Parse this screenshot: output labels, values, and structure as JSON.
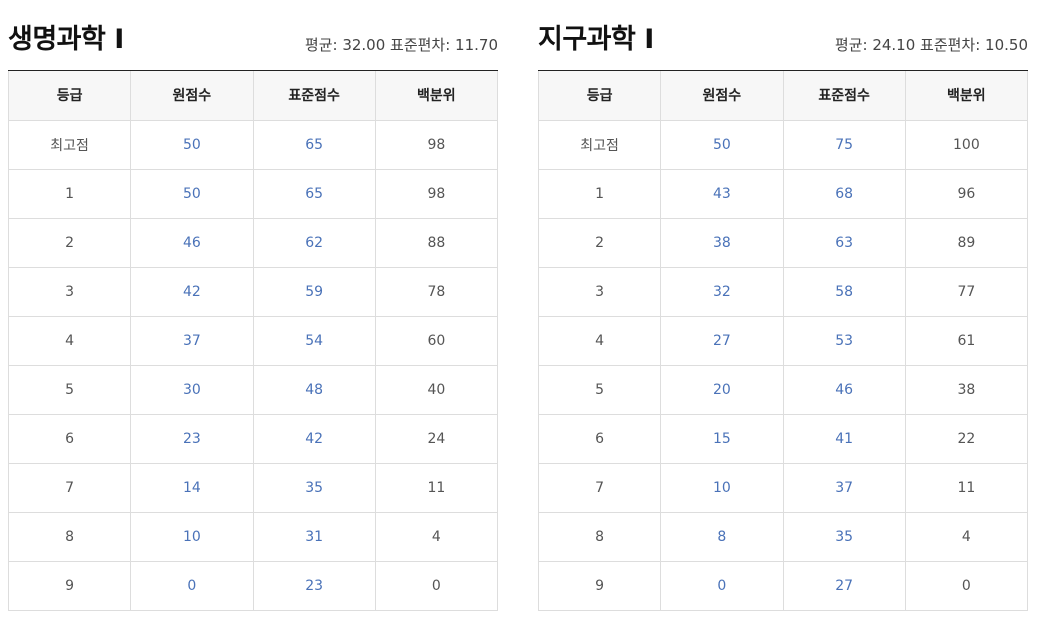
{
  "left": {
    "title": "생명과학 Ⅰ",
    "stats": "평균: 32.00 표준편차: 11.70",
    "headers": [
      "등급",
      "원점수",
      "표준점수",
      "백분위"
    ],
    "rows": [
      [
        "최고점",
        "50",
        "65",
        "98"
      ],
      [
        "1",
        "50",
        "65",
        "98"
      ],
      [
        "2",
        "46",
        "62",
        "88"
      ],
      [
        "3",
        "42",
        "59",
        "78"
      ],
      [
        "4",
        "37",
        "54",
        "60"
      ],
      [
        "5",
        "30",
        "48",
        "40"
      ],
      [
        "6",
        "23",
        "42",
        "24"
      ],
      [
        "7",
        "14",
        "35",
        "11"
      ],
      [
        "8",
        "10",
        "31",
        "4"
      ],
      [
        "9",
        "0",
        "23",
        "0"
      ]
    ]
  },
  "right": {
    "title": "지구과학 Ⅰ",
    "stats": "평균: 24.10 표준편차: 10.50",
    "headers": [
      "등급",
      "원점수",
      "표준점수",
      "백분위"
    ],
    "rows": [
      [
        "최고점",
        "50",
        "75",
        "100"
      ],
      [
        "1",
        "43",
        "68",
        "96"
      ],
      [
        "2",
        "38",
        "63",
        "89"
      ],
      [
        "3",
        "32",
        "58",
        "77"
      ],
      [
        "4",
        "27",
        "53",
        "61"
      ],
      [
        "5",
        "20",
        "46",
        "38"
      ],
      [
        "6",
        "15",
        "41",
        "22"
      ],
      [
        "7",
        "10",
        "37",
        "11"
      ],
      [
        "8",
        "8",
        "35",
        "4"
      ],
      [
        "9",
        "0",
        "27",
        "0"
      ]
    ]
  },
  "colors": {
    "accent_blue": "#4a72b8",
    "header_bg": "#f7f7f7",
    "border": "#dddddd"
  }
}
